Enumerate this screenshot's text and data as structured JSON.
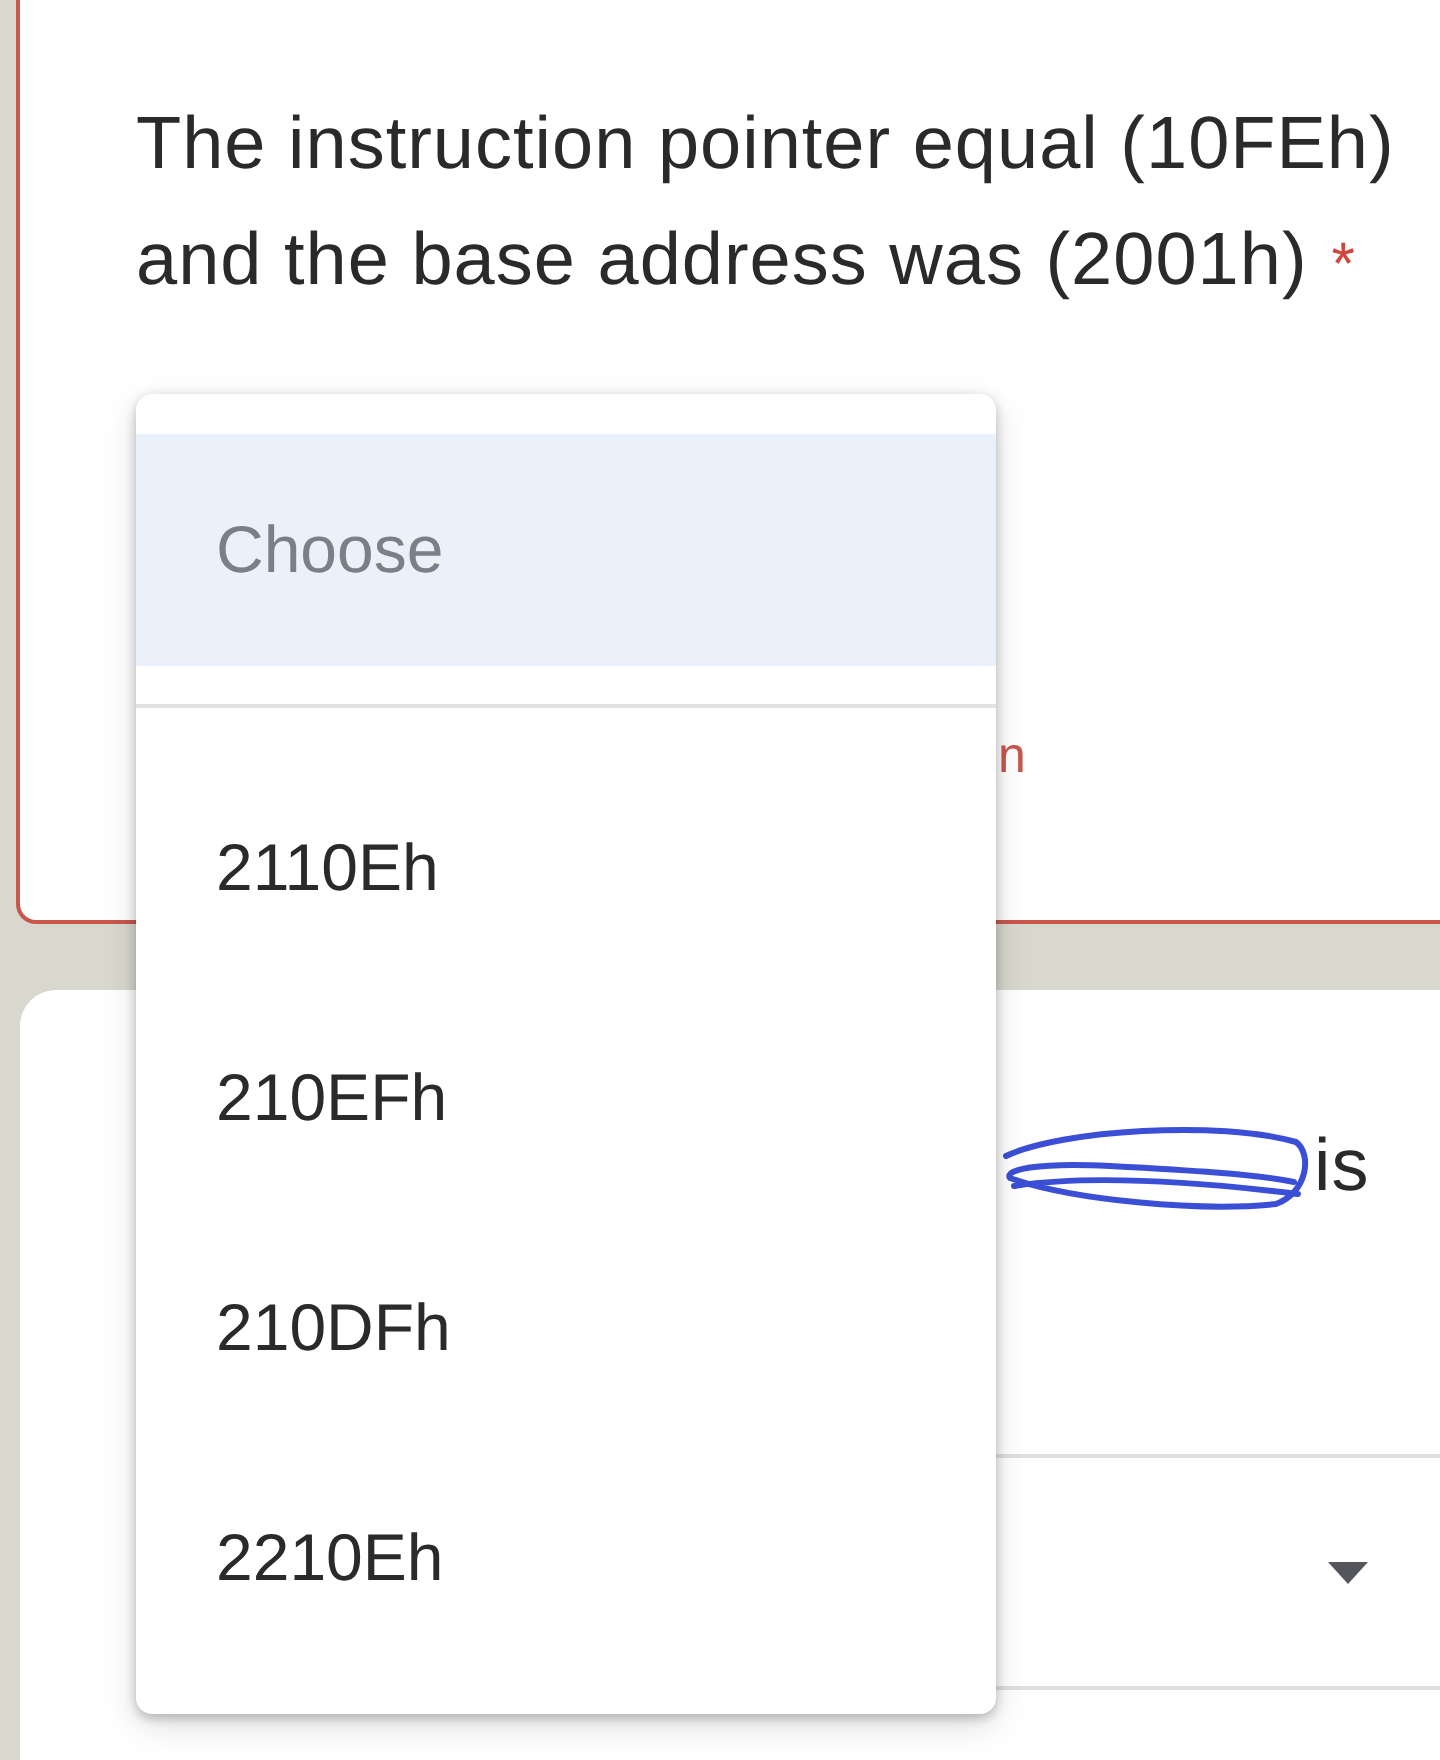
{
  "question_card": {
    "title": "The instruction pointer equal (10FEh) and the base address was (2001h)",
    "required_mark": "*",
    "error": true,
    "error_text": "n"
  },
  "dropdown_menu": {
    "options": [
      {
        "label": "Choose",
        "kind": "placeholder",
        "selected": true
      },
      {
        "label": "2110Eh",
        "kind": "option",
        "selected": false
      },
      {
        "label": "210EFh",
        "kind": "option",
        "selected": false
      },
      {
        "label": "210DFh",
        "kind": "option",
        "selected": false
      },
      {
        "label": "2210Eh",
        "kind": "option",
        "selected": false
      }
    ]
  },
  "next_card": {
    "question_fragment": "is",
    "scribbled": true
  }
}
